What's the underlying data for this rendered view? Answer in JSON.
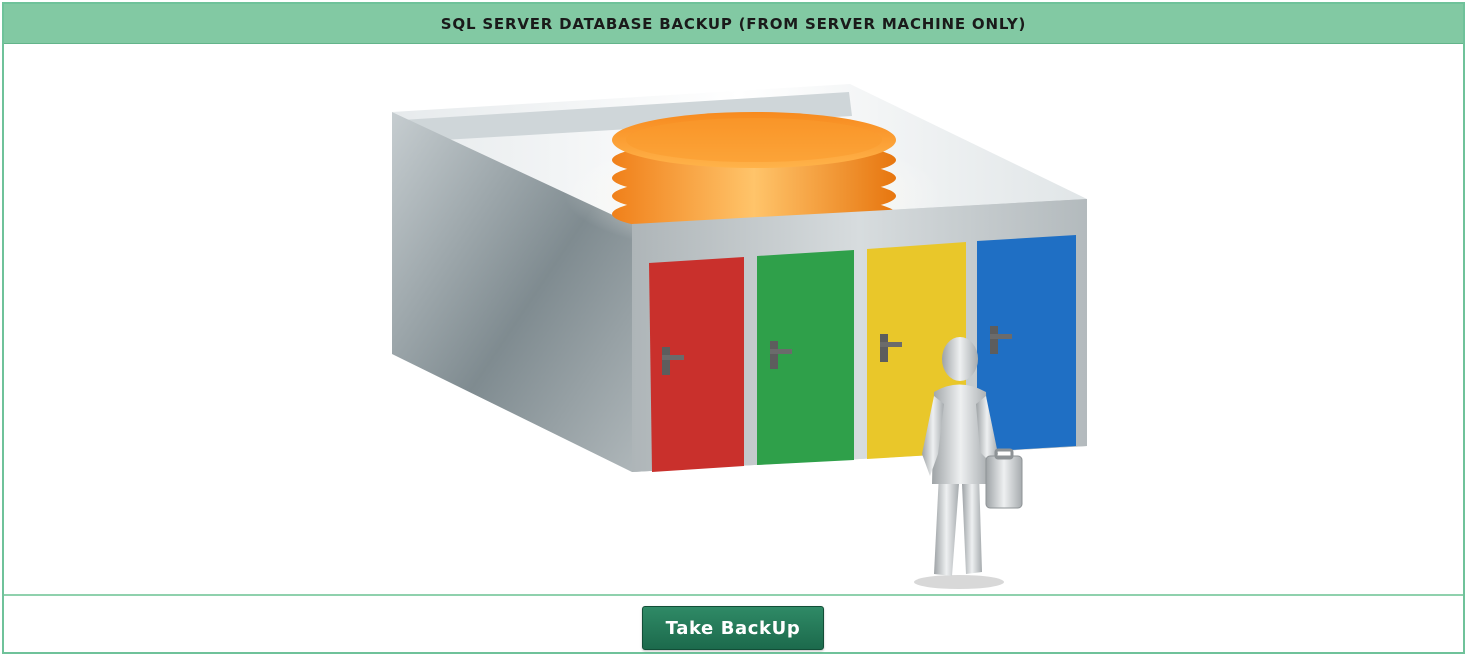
{
  "panel": {
    "title": "SQL SERVER DATABASE BACKUP (FROM SERVER MACHINE ONLY)"
  },
  "illustration": {
    "subject": "database-vault-with-colored-doors",
    "door_colors": [
      "#c9302c",
      "#2fa04a",
      "#e9c72a",
      "#1f6fc4"
    ],
    "disk_color": "#f7931e"
  },
  "actions": {
    "backup_label": "Take BackUp"
  },
  "colors": {
    "header_bg": "#82c9a3",
    "border": "#6fc29a",
    "button_bg": "#1f6f50"
  }
}
